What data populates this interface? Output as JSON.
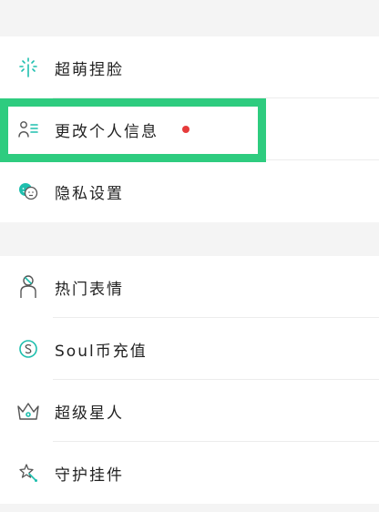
{
  "menu": {
    "group1": [
      {
        "id": "face",
        "label": "超萌捏脸",
        "icon": "sparkle-wand-icon"
      },
      {
        "id": "profile",
        "label": "更改个人信息",
        "icon": "person-list-icon",
        "badge": "red-dot"
      },
      {
        "id": "privacy",
        "label": "隐私设置",
        "icon": "faces-icon"
      }
    ],
    "group2": [
      {
        "id": "emoji",
        "label": "热门表情",
        "icon": "person-ring-icon"
      },
      {
        "id": "coins",
        "label": "Soul币充值",
        "icon": "coin-s-icon"
      },
      {
        "id": "star",
        "label": "超级星人",
        "icon": "crown-icon"
      },
      {
        "id": "pendant",
        "label": "守护挂件",
        "icon": "star-pendant-icon"
      }
    ]
  },
  "colors": {
    "highlight": "#2ecc7f",
    "badge": "#e63b3b",
    "background": "#f4f4f4"
  }
}
